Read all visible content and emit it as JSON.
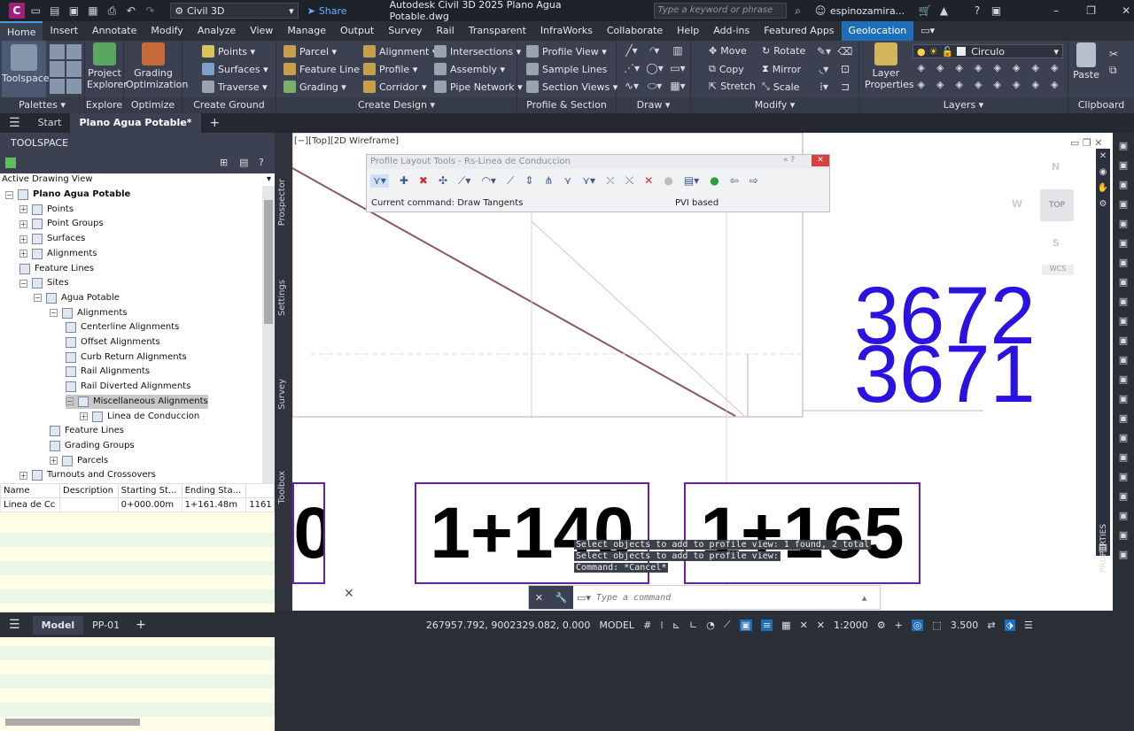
{
  "title_bar": {
    "app_letter": "C",
    "workspace": "Civil 3D",
    "share": "Share",
    "title": "Autodesk Civil 3D 2025   Plano Agua Potable.dwg",
    "search_placeholder": "Type a keyword or phrase",
    "user": "espinozamira..."
  },
  "ribbon_tabs": [
    "Home",
    "Insert",
    "Annotate",
    "Modify",
    "Analyze",
    "View",
    "Manage",
    "Output",
    "Survey",
    "Rail",
    "Transparent",
    "InfraWorks",
    "Collaborate",
    "Help",
    "Add-ins",
    "Featured Apps",
    "Geolocation"
  ],
  "ribbon": {
    "palettes": {
      "toolspace": "Toolspace",
      "title": "Palettes"
    },
    "explore": {
      "project_explorer": "Project Explorer",
      "title": "Explore"
    },
    "optimize": {
      "grading_optimization": "Grading Optimization",
      "title": "Optimize"
    },
    "ground": {
      "points": "Points",
      "surfaces": "Surfaces",
      "traverse": "Traverse",
      "title": "Create Ground Data"
    },
    "design": {
      "parcel": "Parcel",
      "feature_line": "Feature Line",
      "grading": "Grading",
      "alignment": "Alignment",
      "profile": "Profile",
      "corridor": "Corridor",
      "intersections": "Intersections",
      "assembly": "Assembly",
      "pipe_network": "Pipe Network",
      "title": "Create Design"
    },
    "profile_section": {
      "profile_view": "Profile View",
      "sample_lines": "Sample Lines",
      "section_views": "Section Views",
      "title": "Profile & Section Views"
    },
    "draw": {
      "title": "Draw"
    },
    "modify": {
      "move": "Move",
      "copy": "Copy",
      "stretch": "Stretch",
      "rotate": "Rotate",
      "mirror": "Mirror",
      "scale": "Scale",
      "title": "Modify"
    },
    "layers": {
      "layer_properties": "Layer Properties",
      "current_layer": "Circulo",
      "title": "Layers"
    },
    "clipboard": {
      "paste": "Paste",
      "title": "Clipboard"
    }
  },
  "doc_tabs": {
    "start": "Start",
    "active": "Plano Agua Potable*"
  },
  "toolspace": {
    "header": "TOOLSPACE",
    "view": "Active Drawing View",
    "side_tabs": [
      "Prospector",
      "Settings",
      "Survey",
      "Toolbox"
    ],
    "tree": [
      {
        "label": "Plano Agua Potable",
        "level": 0,
        "bold": true
      },
      {
        "label": "Points",
        "level": 1
      },
      {
        "label": "Point Groups",
        "level": 1
      },
      {
        "label": "Surfaces",
        "level": 1
      },
      {
        "label": "Alignments",
        "level": 1
      },
      {
        "label": "Feature Lines",
        "level": 1
      },
      {
        "label": "Sites",
        "level": 1
      },
      {
        "label": "Agua Potable",
        "level": 2
      },
      {
        "label": "Alignments",
        "level": 3
      },
      {
        "label": "Centerline Alignments",
        "level": 4
      },
      {
        "label": "Offset Alignments",
        "level": 4
      },
      {
        "label": "Curb Return Alignments",
        "level": 4
      },
      {
        "label": "Rail Alignments",
        "level": 4
      },
      {
        "label": "Rail Diverted Alignments",
        "level": 4
      },
      {
        "label": "Miscellaneous Alignments",
        "level": 4,
        "selected": true
      },
      {
        "label": "Linea de Conduccion",
        "level": 5
      },
      {
        "label": "Feature Lines",
        "level": 3
      },
      {
        "label": "Grading Groups",
        "level": 3
      },
      {
        "label": "Parcels",
        "level": 3
      },
      {
        "label": "Turnouts and Crossovers",
        "level": 1
      }
    ],
    "grid": {
      "columns": [
        "Name",
        "Description",
        "Starting St...",
        "Ending Sta...",
        ""
      ],
      "rows": [
        [
          "Linea de Cc",
          "",
          "0+000.00m",
          "1+161.48m",
          "1161"
        ]
      ]
    }
  },
  "viewport": {
    "caption": "[−][Top][2D Wireframe]",
    "compass": {
      "n": "N",
      "w": "W",
      "s": "S",
      "top": "TOP",
      "wcs": "WCS"
    }
  },
  "profile_tools": {
    "title": "Profile Layout Tools - Rs-Linea de Conduccion",
    "current_command": "Current command: Draw Tangents",
    "mode": "PVI based"
  },
  "drawing": {
    "elevation_top": "3672",
    "elevation_bottom": "3671",
    "station_left": "0",
    "station_mid": "1+140",
    "station_right": "1+165"
  },
  "command_history": [
    "Select objects to add to profile view: 1 found, 2 total",
    "Select objects to add to profile view:",
    "Command: *Cancel*"
  ],
  "command_line": {
    "placeholder": "Type a command"
  },
  "status_bar": {
    "model_tab": "Model",
    "layout_tab": "PP-01",
    "coords": "267957.792, 9002329.082, 0.000",
    "space": "MODEL",
    "scale": "1:2000",
    "value": "3.500"
  },
  "right_palette": {
    "properties": "PROPERTIES"
  }
}
